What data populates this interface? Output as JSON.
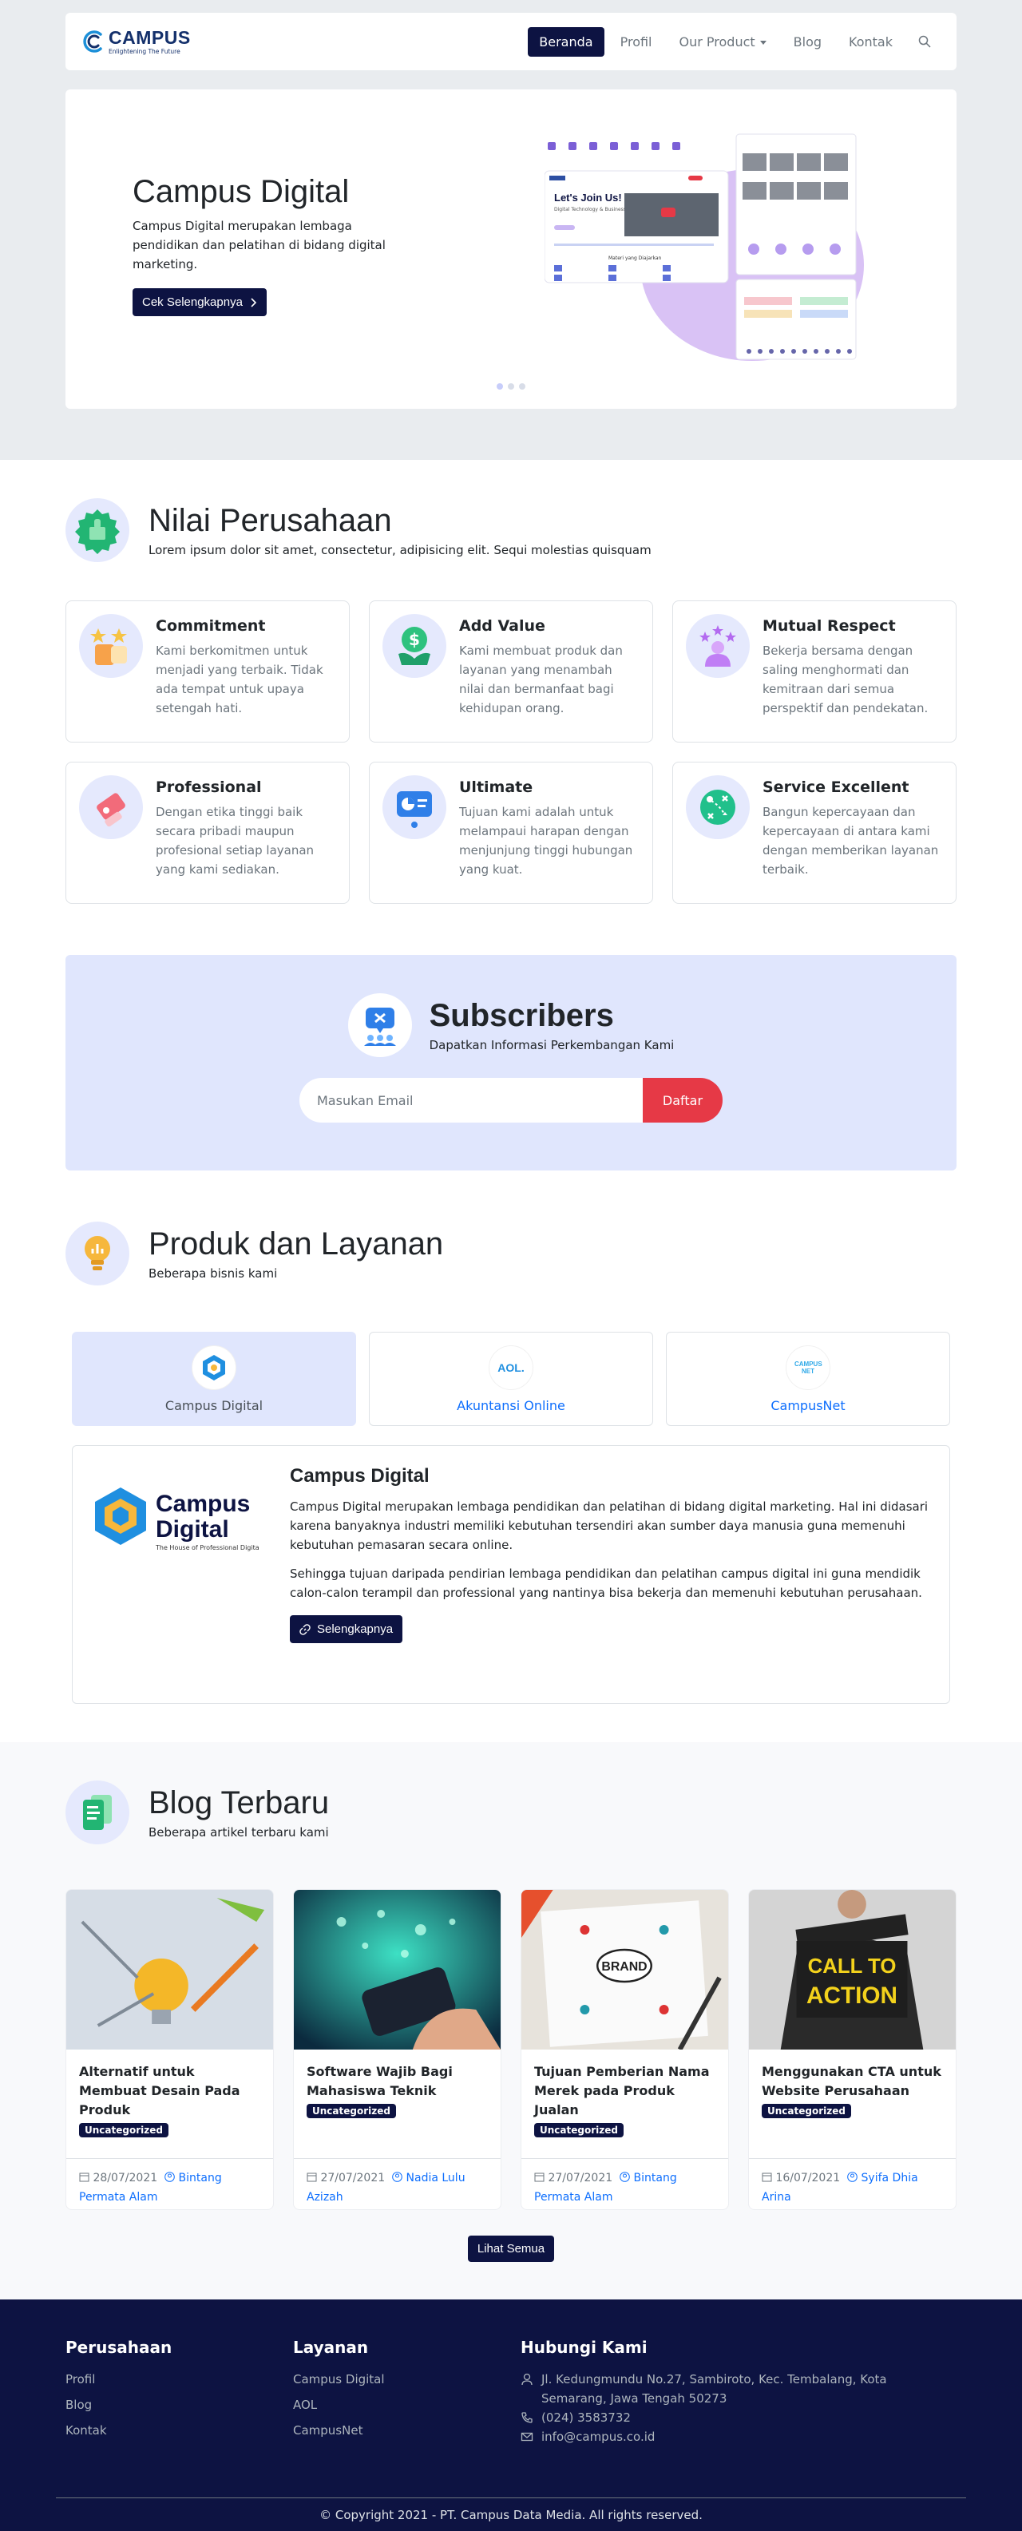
{
  "nav": {
    "logo_name": "CAMPUS",
    "logo_tag": "Enlightening The Future",
    "items": [
      {
        "label": "Beranda"
      },
      {
        "label": "Profil"
      },
      {
        "label": "Our Product"
      },
      {
        "label": "Blog"
      },
      {
        "label": "Kontak"
      }
    ]
  },
  "hero": {
    "title": "Campus Digital",
    "desc": "Campus Digital merupakan lembaga pendidikan dan pelatihan di bidang digital marketing.",
    "button": "Cek Selengkapnya",
    "mock_heading": "Let's Join Us!",
    "mock_sub": "Digital Technology & Business Class",
    "mock_section": "Materi yang Diajarkan"
  },
  "values": {
    "title": "Nilai Perusahaan",
    "subtitle": "Lorem ipsum dolor sit amet, consectetur, adipisicing elit. Sequi molestias quisquam",
    "items": [
      {
        "title": "Commitment",
        "desc": "Kami berkomitmen untuk menjadi yang terbaik. Tidak ada tempat untuk upaya setengah hati."
      },
      {
        "title": "Add Value",
        "desc": "Kami membuat produk dan layanan yang menambah nilai dan bermanfaat bagi kehidupan orang."
      },
      {
        "title": "Mutual Respect",
        "desc": "Bekerja bersama dengan saling menghormati dan kemitraan dari semua perspektif dan pendekatan."
      },
      {
        "title": "Professional",
        "desc": "Dengan etika tinggi baik secara pribadi maupun profesional setiap layanan yang kami sediakan."
      },
      {
        "title": "Ultimate",
        "desc": "Tujuan kami adalah untuk melampaui harapan dengan menjunjung tinggi hubungan yang kuat."
      },
      {
        "title": "Service Excellent",
        "desc": "Bangun kepercayaan dan kepercayaan di antara kami dengan memberikan layanan terbaik."
      }
    ]
  },
  "subscribe": {
    "title": "Subscribers",
    "subtitle": "Dapatkan Informasi Perkembangan Kami",
    "placeholder": "Masukan Email",
    "button": "Daftar"
  },
  "products": {
    "title": "Produk dan Layanan",
    "subtitle": "Beberapa bisnis kami",
    "tabs": [
      {
        "label": "Campus Digital"
      },
      {
        "label": "Akuntansi Online",
        "logo": "AOL."
      },
      {
        "label": "CampusNet",
        "logo": "CAMPUS NET"
      }
    ],
    "panel": {
      "logo_line1": "Campus",
      "logo_line2": "Digital",
      "logo_small": "The House of Professional Digital Marketing",
      "title": "Campus Digital",
      "p1": "Campus Digital merupakan lembaga pendidikan dan pelatihan di bidang digital marketing. Hal ini didasari karena banyaknya industri memiliki kebutuhan tersendiri akan sumber daya manusia guna memenuhi kebutuhan pemasaran secara online.",
      "p2": "Sehingga tujuan daripada pendirian lembaga pendidikan dan pelatihan campus digital ini guna mendidik calon-calon terampil dan professional yang nantinya bisa bekerja dan memenuhi kebutuhan perusahaan.",
      "button": "Selengkapnya"
    }
  },
  "blog": {
    "title": "Blog Terbaru",
    "subtitle": "Beberapa artikel terbaru kami",
    "posts": [
      {
        "title": "Alternatif untuk Membuat Desain Pada Produk",
        "badge": "Uncategorized",
        "date": "28/07/2021",
        "author": "Bintang Permata Alam"
      },
      {
        "title": "Software Wajib Bagi Mahasiswa Teknik",
        "badge": "Uncategorized",
        "date": "27/07/2021",
        "author": "Nadia Lulu Azizah"
      },
      {
        "title": "Tujuan Pemberian Nama Merek pada Produk Jualan",
        "badge": "Uncategorized",
        "date": "27/07/2021",
        "author": "Bintang Permata Alam",
        "image_text": "BRAND"
      },
      {
        "title": "Menggunakan CTA untuk Website Perusahaan",
        "badge": "Uncategorized",
        "date": "16/07/2021",
        "author": "Syifa Dhia Arina",
        "image_text_1": "CALL TO",
        "image_text_2": "ACTION"
      }
    ],
    "button": "Lihat Semua"
  },
  "footer": {
    "col1": {
      "title": "Perusahaan",
      "links": [
        "Profil",
        "Blog",
        "Kontak"
      ]
    },
    "col2": {
      "title": "Layanan",
      "links": [
        "Campus Digital",
        "AOL",
        "CampusNet"
      ]
    },
    "col3": {
      "title": "Hubungi Kami",
      "address": "Jl. Kedungmundu No.27, Sambiroto, Kec. Tembalang, Kota Semarang, Jawa Tengah 50273",
      "phone": "(024) 3583732",
      "email": "info@campus.co.id"
    },
    "copyright": "© Copyright 2021 - PT. Campus Data Media. All rights reserved."
  },
  "colors": {
    "navy": "#0d1342",
    "accent_light": "#e0e6fd",
    "red": "#e63946",
    "link": "#0d6efd",
    "page_grey": "#e9ecef"
  },
  "icons": [
    "search-icon",
    "chevron-right-icon",
    "link-icon",
    "calendar-icon",
    "user-icon",
    "map-pin-icon",
    "phone-icon",
    "mail-icon"
  ]
}
